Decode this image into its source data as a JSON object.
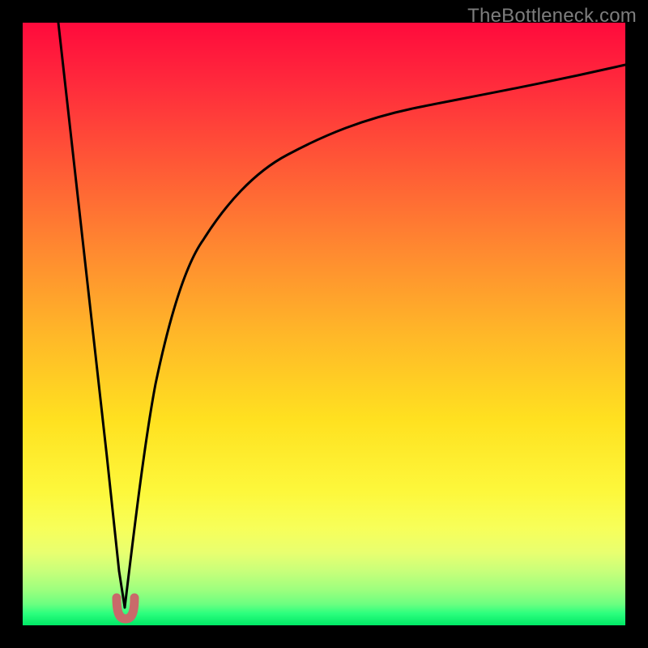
{
  "watermark": "TheBottleneck.com",
  "colors": {
    "frame": "#000000",
    "curve_stroke": "#000000",
    "accent_marker": "#c96a6a",
    "gradient_top": "#ff0a3c",
    "gradient_bottom": "#00e866"
  },
  "chart_data": {
    "type": "line",
    "title": "",
    "xlabel": "",
    "ylabel": "",
    "note": "Bottleneck-style V curve: minimum (optimal) near x≈17 on a 0–100 horizontal scale; y is a qualitative 0–100 scale (0=green/good at bottom, 100=red/bad at top).",
    "xlim": [
      0,
      100
    ],
    "ylim": [
      0,
      100
    ],
    "series": [
      {
        "name": "left-branch",
        "x": [
          6,
          8,
          10,
          12,
          14,
          16,
          17
        ],
        "y": [
          100,
          82,
          64,
          46,
          28,
          9,
          3
        ]
      },
      {
        "name": "right-branch",
        "x": [
          17,
          19,
          22,
          26,
          30,
          36,
          44,
          54,
          66,
          80,
          100
        ],
        "y": [
          3,
          20,
          40,
          55,
          64,
          72,
          78,
          83,
          87,
          90,
          93
        ]
      }
    ],
    "marker": {
      "x": 17,
      "y": 3,
      "shape": "u",
      "color": "#c96a6a"
    }
  }
}
